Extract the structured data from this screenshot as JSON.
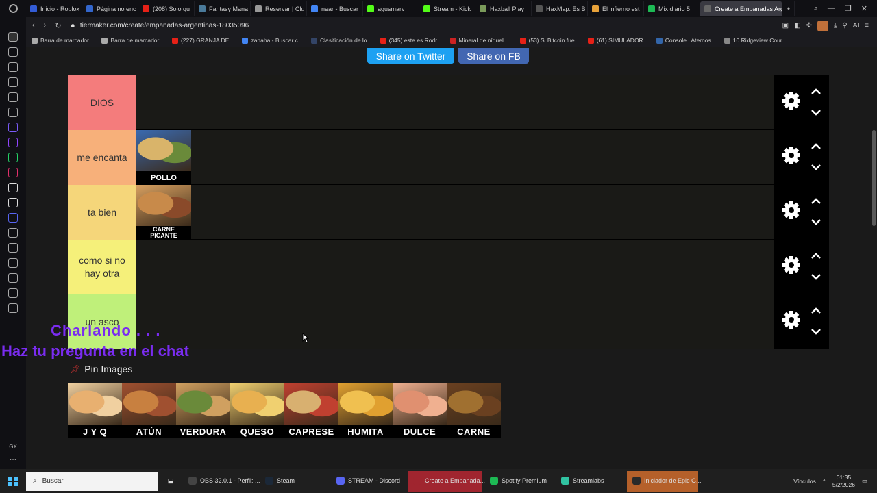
{
  "browser": {
    "tabs": [
      {
        "label": "Inicio - Roblox",
        "color": "#335cd6"
      },
      {
        "label": "Página no enc",
        "color": "#3366cc"
      },
      {
        "label": "(208) Solo qu",
        "color": "#e62117"
      },
      {
        "label": "Fantasy Mana",
        "color": "#4a7a9a"
      },
      {
        "label": "Reservar | Clu",
        "color": "#999999"
      },
      {
        "label": "near - Buscar",
        "color": "#4285f4"
      },
      {
        "label": "agusmarv",
        "color": "#53fc18"
      },
      {
        "label": "Stream - Kick",
        "color": "#53fc18"
      },
      {
        "label": "Haxball Play",
        "color": "#7a9a5a"
      },
      {
        "label": "HaxMap: Es B",
        "color": "#555555"
      },
      {
        "label": "El infierno est",
        "color": "#e8a23a"
      },
      {
        "label": "Mix diario 5",
        "color": "#1db954"
      },
      {
        "label": "Create a Empanadas Arg",
        "color": "#666666"
      }
    ],
    "url": "tiermaker.com/create/empanadas-argentinas-18035096",
    "ai_label": "AI",
    "bookmarks": [
      {
        "label": "Barra de marcador...",
        "color": "#aaaaaa"
      },
      {
        "label": "Barra de marcador...",
        "color": "#aaaaaa"
      },
      {
        "label": "(227) GRANJA DE...",
        "color": "#e62117"
      },
      {
        "label": "zanaha - Buscar c...",
        "color": "#4285f4"
      },
      {
        "label": "Clasificación de lo...",
        "color": "#334466"
      },
      {
        "label": "(345) este es Rodr...",
        "color": "#e62117"
      },
      {
        "label": "Mineral de níquel |...",
        "color": "#cc2222"
      },
      {
        "label": "(53) Si Bitcoin fue...",
        "color": "#e62117"
      },
      {
        "label": "(61) SIMULADOR...",
        "color": "#e62117"
      },
      {
        "label": "Console | Aternos...",
        "color": "#3366aa"
      },
      {
        "label": "10 Ridgeview Cour...",
        "color": "#888888"
      }
    ],
    "gx_label": "GX",
    "sidebar_icons": [
      "home-icon",
      "games-icon",
      "refresh-icon",
      "news-icon",
      "m-icon",
      "chatgpt-icon",
      "gx-icon",
      "twitch-icon",
      "whatsapp-icon",
      "instagram-icon",
      "tiktok-icon",
      "x-icon",
      "discord-icon",
      "player-icon",
      "send-icon",
      "wallet-icon",
      "history-icon",
      "extensions-icon",
      "settings-icon"
    ]
  },
  "page": {
    "share_twitter": "Share on Twitter",
    "share_fb": "Share on FB",
    "tiers": [
      {
        "label": "DIOS",
        "color": "#f47c7c",
        "items": []
      },
      {
        "label": "me encanta",
        "color": "#f7b07a",
        "items": [
          {
            "caption": "POLLO",
            "colors": [
              "#d9b46a",
              "#6a8a3a",
              "#3a6ab0"
            ]
          }
        ]
      },
      {
        "label": "ta bien",
        "color": "#f5d67a",
        "items": [
          {
            "caption": "CARNE PICANTE",
            "colors": [
              "#c88a4a",
              "#8a4a2a",
              "#d8a060"
            ]
          }
        ]
      },
      {
        "label": "como si no hay otra",
        "color": "#f5f07a",
        "items": []
      },
      {
        "label": "un asco",
        "color": "#bff07a",
        "items": []
      }
    ],
    "pin_label": "Pin Images",
    "pool": [
      {
        "caption": "J Y Q",
        "colors": [
          "#e8b070",
          "#f0d0a0"
        ]
      },
      {
        "caption": "ATÚN",
        "colors": [
          "#c88040",
          "#a05030"
        ]
      },
      {
        "caption": "VERDURA",
        "colors": [
          "#6a8a3a",
          "#d0a060"
        ]
      },
      {
        "caption": "QUESO",
        "colors": [
          "#e8b050",
          "#f0d070"
        ]
      },
      {
        "caption": "CAPRESE",
        "colors": [
          "#d8b070",
          "#c04030"
        ]
      },
      {
        "caption": "HUMITA",
        "colors": [
          "#f0c050",
          "#e0a030"
        ]
      },
      {
        "caption": "DULCE",
        "colors": [
          "#e09070",
          "#f0b090"
        ]
      },
      {
        "caption": "CARNE",
        "colors": [
          "#a07030",
          "#6a4020"
        ]
      }
    ],
    "overlay_line1": "Charlando . . .",
    "overlay_line2": "Haz tu pregunta en el chat"
  },
  "taskbar": {
    "search_placeholder": "Buscar",
    "apps": [
      {
        "label": "OBS 32.0.1 - Perfil: ...",
        "color": "#444444",
        "style": ""
      },
      {
        "label": "Steam",
        "color": "#1b2838",
        "style": ""
      },
      {
        "label": "STREAM - Discord",
        "color": "#5865f2",
        "style": ""
      },
      {
        "label": "Create a Empanada...",
        "color": "#a0252f",
        "style": "red"
      },
      {
        "label": "Spotify Premium",
        "color": "#1db954",
        "style": ""
      },
      {
        "label": "Streamlabs",
        "color": "#31c3a2",
        "style": ""
      },
      {
        "label": "Iniciador de Epic G...",
        "color": "#2a2a2a",
        "style": "orange"
      }
    ],
    "tray_label": "Vínculos",
    "time": "01:35",
    "date": "5/2/2026"
  }
}
